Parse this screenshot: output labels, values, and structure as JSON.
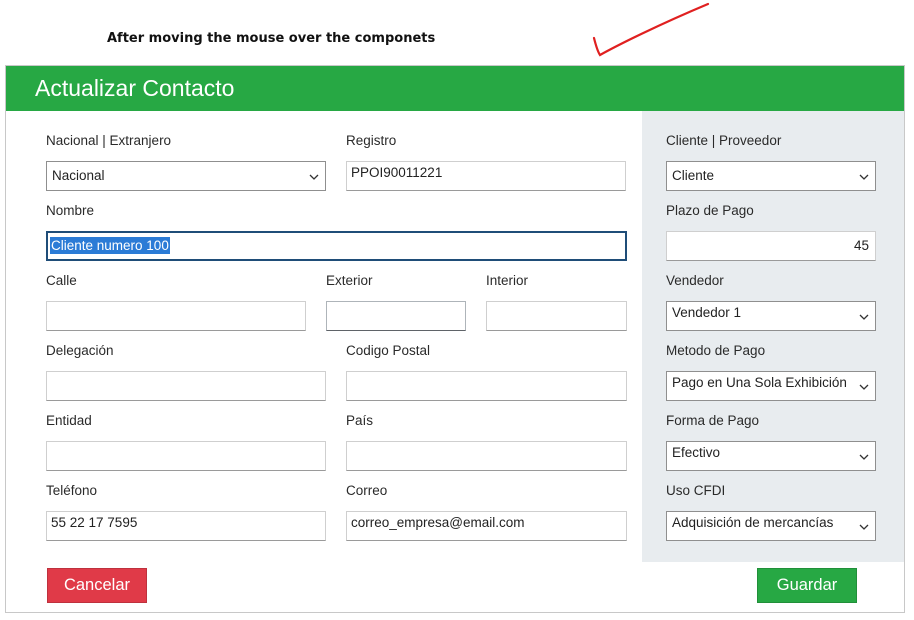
{
  "annotation": "After moving the mouse over the componets",
  "colors": {
    "header": "#27a844",
    "cancel": "#e03a48",
    "save": "#27a844",
    "side_panel": "#e8ecef",
    "checkmark": "#e02020"
  },
  "dialog": {
    "title": "Actualizar Contacto",
    "fields": {
      "nacional": {
        "label": "Nacional | Extranjero",
        "value": "Nacional"
      },
      "registro": {
        "label": "Registro",
        "value": "PPOI90011221"
      },
      "nombre": {
        "label": "Nombre",
        "value": "Cliente numero 100"
      },
      "calle": {
        "label": "Calle",
        "value": ""
      },
      "exterior": {
        "label": "Exterior",
        "value": ""
      },
      "interior": {
        "label": "Interior",
        "value": ""
      },
      "delegacion": {
        "label": "Delegación",
        "value": ""
      },
      "codigo_postal": {
        "label": "Codigo Postal",
        "value": ""
      },
      "entidad": {
        "label": "Entidad",
        "value": ""
      },
      "pais": {
        "label": "País",
        "value": ""
      },
      "telefono": {
        "label": "Teléfono",
        "value": "55 22 17 7595"
      },
      "correo": {
        "label": "Correo",
        "value": "correo_empresa@email.com"
      }
    },
    "side": {
      "cliente_proveedor": {
        "label": "Cliente | Proveedor",
        "value": "Cliente"
      },
      "plazo_pago": {
        "label": "Plazo de Pago",
        "value": "45"
      },
      "vendedor": {
        "label": "Vendedor",
        "value": "Vendedor 1"
      },
      "metodo_pago": {
        "label": "Metodo de Pago",
        "value": "Pago en Una Sola Exhibición"
      },
      "forma_pago": {
        "label": "Forma de Pago",
        "value": "Efectivo"
      },
      "uso_cfdi": {
        "label": "Uso CFDI",
        "value": "Adquisición de mercancías"
      }
    },
    "buttons": {
      "cancel": "Cancelar",
      "save": "Guardar"
    }
  },
  "icons": {
    "dropdown": "chevron-down-icon",
    "annotation_mark": "checkmark-icon"
  }
}
